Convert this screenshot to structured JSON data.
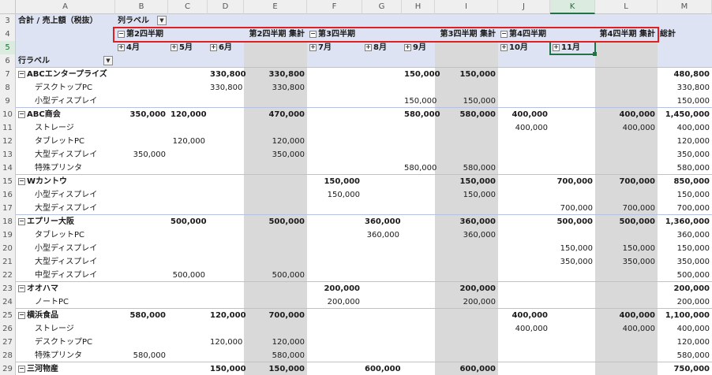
{
  "columns": [
    "A",
    "B",
    "C",
    "D",
    "E",
    "F",
    "G",
    "H",
    "I",
    "J",
    "K",
    "L",
    "M"
  ],
  "selected_column": "K",
  "selected_row": "5",
  "pivot": {
    "corner_label": "合計 / 売上額（税抜）",
    "column_labels": "列ラベル",
    "row_labels": "行ラベル",
    "grand_total_label": "総計",
    "quarters": [
      {
        "label": "第2四半期",
        "total_label": "第2四半期 集計",
        "months": [
          "4月",
          "5月",
          "6月"
        ]
      },
      {
        "label": "第3四半期",
        "total_label": "第3四半期 集計",
        "months": [
          "7月",
          "8月",
          "9月"
        ]
      },
      {
        "label": "第4四半期",
        "total_label": "第4四半期 集計",
        "months": [
          "10月",
          "11月"
        ]
      }
    ],
    "toggle_collapse": "⊟",
    "toggle_expand": "⊞",
    "dropdown_glyph": "▼"
  },
  "rows": [
    {
      "num": "7",
      "label": "ABCエンタープライズ",
      "group": true,
      "v": [
        "",
        "",
        "330,800",
        "330,800",
        "",
        "",
        "150,000",
        "150,000",
        "",
        "",
        "",
        "480,800"
      ]
    },
    {
      "num": "8",
      "label": "デスクトップPC",
      "group": false,
      "v": [
        "",
        "",
        "330,800",
        "330,800",
        "",
        "",
        "",
        "",
        "",
        "",
        "",
        "330,800"
      ]
    },
    {
      "num": "9",
      "label": "小型ディスプレイ",
      "group": false,
      "v": [
        "",
        "",
        "",
        "",
        "",
        "",
        "150,000",
        "150,000",
        "",
        "",
        "",
        "150,000"
      ]
    },
    {
      "num": "10",
      "label": "ABC商会",
      "group": true,
      "v": [
        "350,000",
        "120,000",
        "",
        "470,000",
        "",
        "",
        "580,000",
        "580,000",
        "400,000",
        "",
        "400,000",
        "1,450,000"
      ]
    },
    {
      "num": "11",
      "label": "ストレージ",
      "group": false,
      "v": [
        "",
        "",
        "",
        "",
        "",
        "",
        "",
        "",
        "400,000",
        "",
        "400,000",
        "400,000"
      ]
    },
    {
      "num": "12",
      "label": "タブレットPC",
      "group": false,
      "v": [
        "",
        "120,000",
        "",
        "120,000",
        "",
        "",
        "",
        "",
        "",
        "",
        "",
        "120,000"
      ]
    },
    {
      "num": "13",
      "label": "大型ディスプレイ",
      "group": false,
      "v": [
        "350,000",
        "",
        "",
        "350,000",
        "",
        "",
        "",
        "",
        "",
        "",
        "",
        "350,000"
      ]
    },
    {
      "num": "14",
      "label": "特殊プリンタ",
      "group": false,
      "v": [
        "",
        "",
        "",
        "",
        "",
        "",
        "580,000",
        "580,000",
        "",
        "",
        "",
        "580,000"
      ]
    },
    {
      "num": "15",
      "label": "Wカントウ",
      "group": true,
      "v": [
        "",
        "",
        "",
        "",
        "150,000",
        "",
        "",
        "150,000",
        "",
        "700,000",
        "700,000",
        "850,000"
      ]
    },
    {
      "num": "16",
      "label": "小型ディスプレイ",
      "group": false,
      "v": [
        "",
        "",
        "",
        "",
        "150,000",
        "",
        "",
        "150,000",
        "",
        "",
        "",
        "150,000"
      ]
    },
    {
      "num": "17",
      "label": "大型ディスプレイ",
      "group": false,
      "v": [
        "",
        "",
        "",
        "",
        "",
        "",
        "",
        "",
        "",
        "700,000",
        "700,000",
        "700,000"
      ]
    },
    {
      "num": "18",
      "label": "エプリー大阪",
      "group": true,
      "v": [
        "",
        "500,000",
        "",
        "500,000",
        "",
        "360,000",
        "",
        "360,000",
        "",
        "500,000",
        "500,000",
        "1,360,000"
      ]
    },
    {
      "num": "19",
      "label": "タブレットPC",
      "group": false,
      "v": [
        "",
        "",
        "",
        "",
        "",
        "360,000",
        "",
        "360,000",
        "",
        "",
        "",
        "360,000"
      ]
    },
    {
      "num": "20",
      "label": "小型ディスプレイ",
      "group": false,
      "v": [
        "",
        "",
        "",
        "",
        "",
        "",
        "",
        "",
        "",
        "150,000",
        "150,000",
        "150,000"
      ]
    },
    {
      "num": "21",
      "label": "大型ディスプレイ",
      "group": false,
      "v": [
        "",
        "",
        "",
        "",
        "",
        "",
        "",
        "",
        "",
        "350,000",
        "350,000",
        "350,000"
      ]
    },
    {
      "num": "22",
      "label": "中型ディスプレイ",
      "group": false,
      "v": [
        "",
        "500,000",
        "",
        "500,000",
        "",
        "",
        "",
        "",
        "",
        "",
        "",
        "500,000"
      ]
    },
    {
      "num": "23",
      "label": "オオハマ",
      "group": true,
      "v": [
        "",
        "",
        "",
        "",
        "200,000",
        "",
        "",
        "200,000",
        "",
        "",
        "",
        "200,000"
      ]
    },
    {
      "num": "24",
      "label": "ノートPC",
      "group": false,
      "v": [
        "",
        "",
        "",
        "",
        "200,000",
        "",
        "",
        "200,000",
        "",
        "",
        "",
        "200,000"
      ]
    },
    {
      "num": "25",
      "label": "横浜食品",
      "group": true,
      "v": [
        "580,000",
        "",
        "120,000",
        "700,000",
        "",
        "",
        "",
        "",
        "400,000",
        "",
        "400,000",
        "1,100,000"
      ]
    },
    {
      "num": "26",
      "label": "ストレージ",
      "group": false,
      "v": [
        "",
        "",
        "",
        "",
        "",
        "",
        "",
        "",
        "400,000",
        "",
        "400,000",
        "400,000"
      ]
    },
    {
      "num": "27",
      "label": "デスクトップPC",
      "group": false,
      "v": [
        "",
        "",
        "120,000",
        "120,000",
        "",
        "",
        "",
        "",
        "",
        "",
        "",
        "120,000"
      ]
    },
    {
      "num": "28",
      "label": "特殊プリンタ",
      "group": false,
      "v": [
        "580,000",
        "",
        "",
        "580,000",
        "",
        "",
        "",
        "",
        "",
        "",
        "",
        "580,000"
      ]
    },
    {
      "num": "29",
      "label": "三河物産",
      "group": true,
      "v": [
        "",
        "",
        "150,000",
        "150,000",
        "",
        "600,000",
        "",
        "600,000",
        "",
        "",
        "",
        "750,000"
      ]
    }
  ]
}
